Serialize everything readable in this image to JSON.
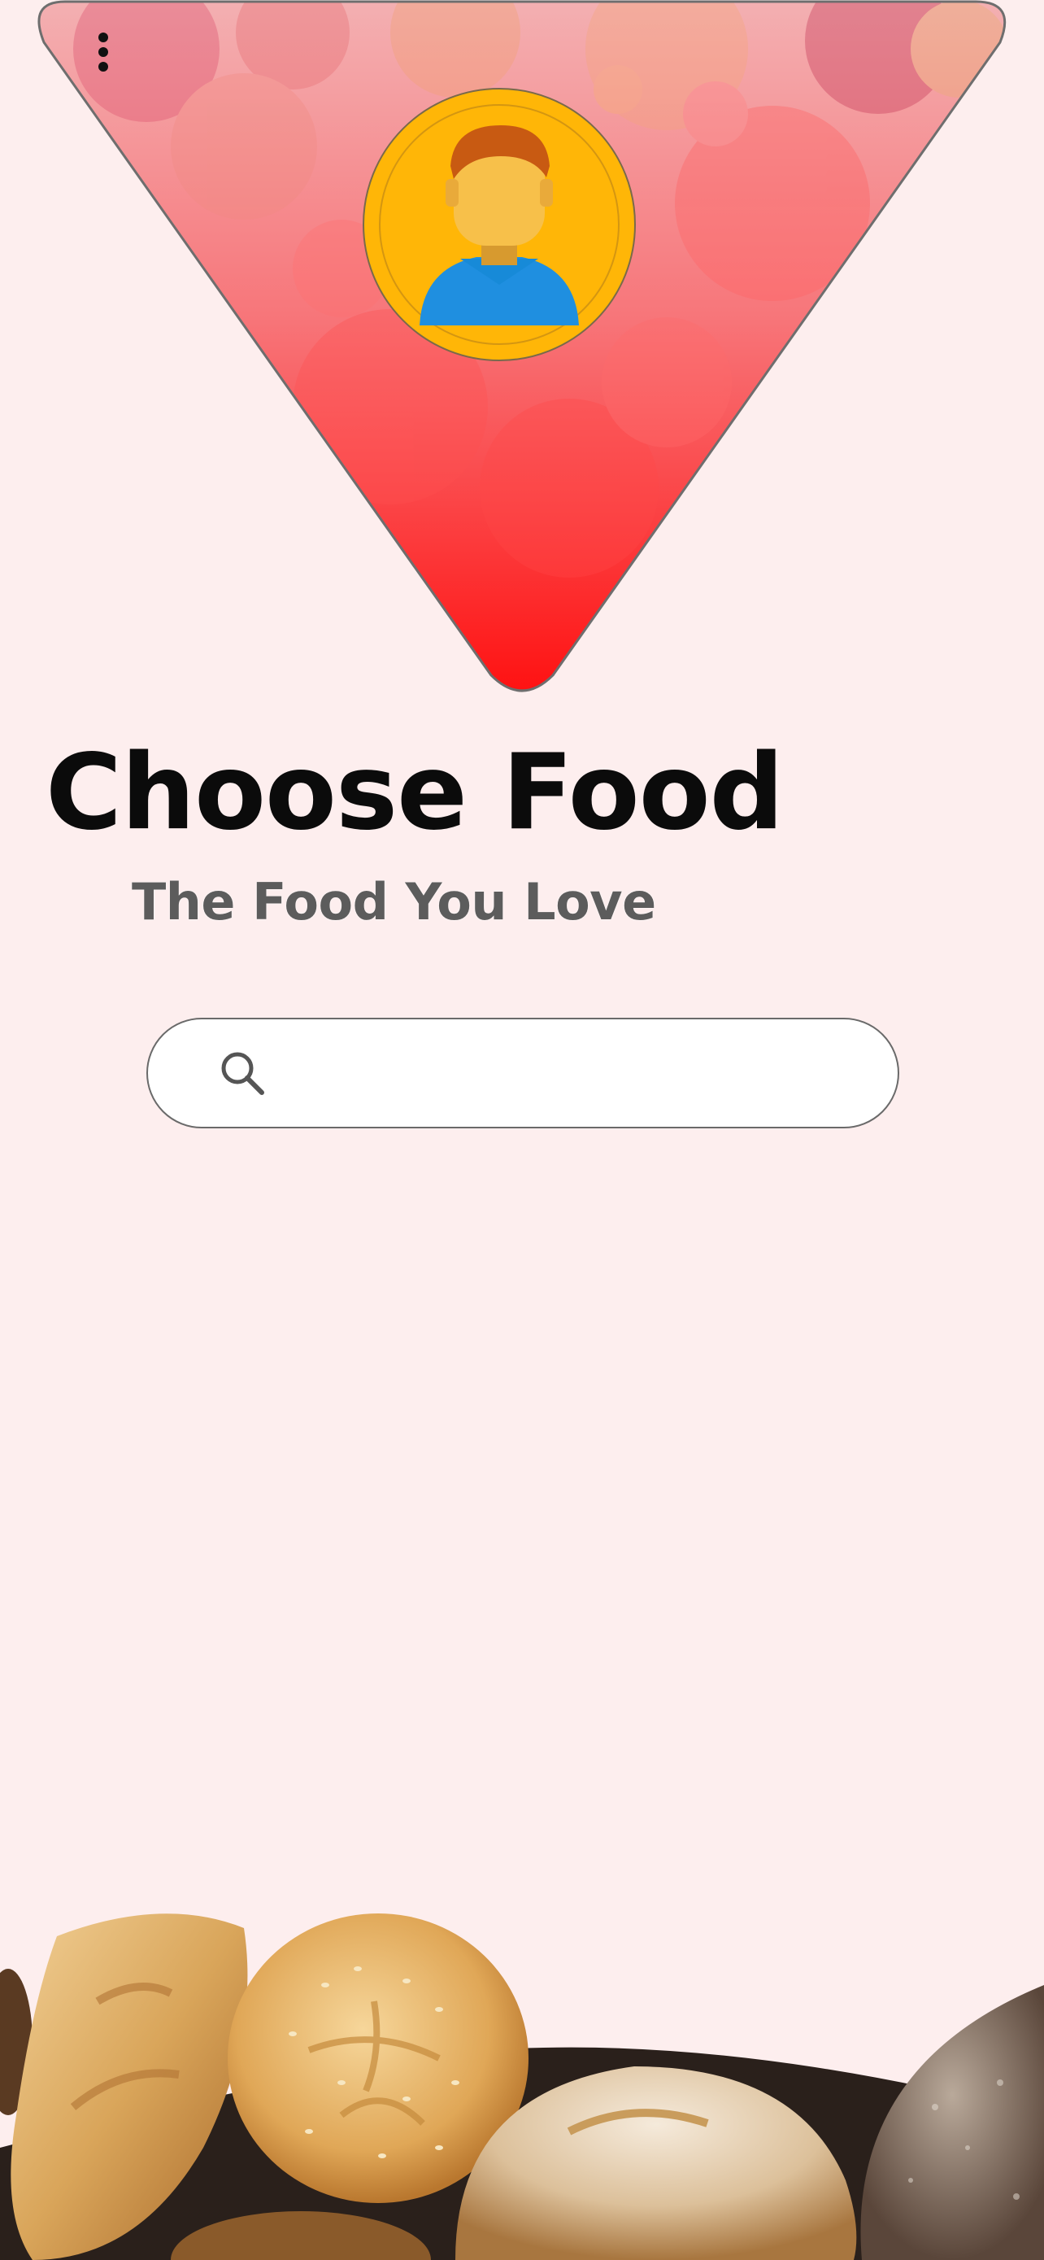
{
  "header": {
    "menu_icon": "more-vertical-icon",
    "avatar_icon": "user-avatar-icon",
    "background_image": "fruit-collage"
  },
  "main": {
    "title": "Choose Food",
    "subtitle": "The Food You Love"
  },
  "search": {
    "icon": "search-icon",
    "value": "",
    "placeholder": ""
  },
  "footer": {
    "decoration_image": "bread-loaves"
  },
  "colors": {
    "background": "#fdeeee",
    "triangle_top": "#f0a6a8",
    "triangle_bottom": "#ff1a1a",
    "avatar_bg": "#ffb607",
    "title": "#0b0b0b",
    "subtitle": "#5c5c5c"
  }
}
